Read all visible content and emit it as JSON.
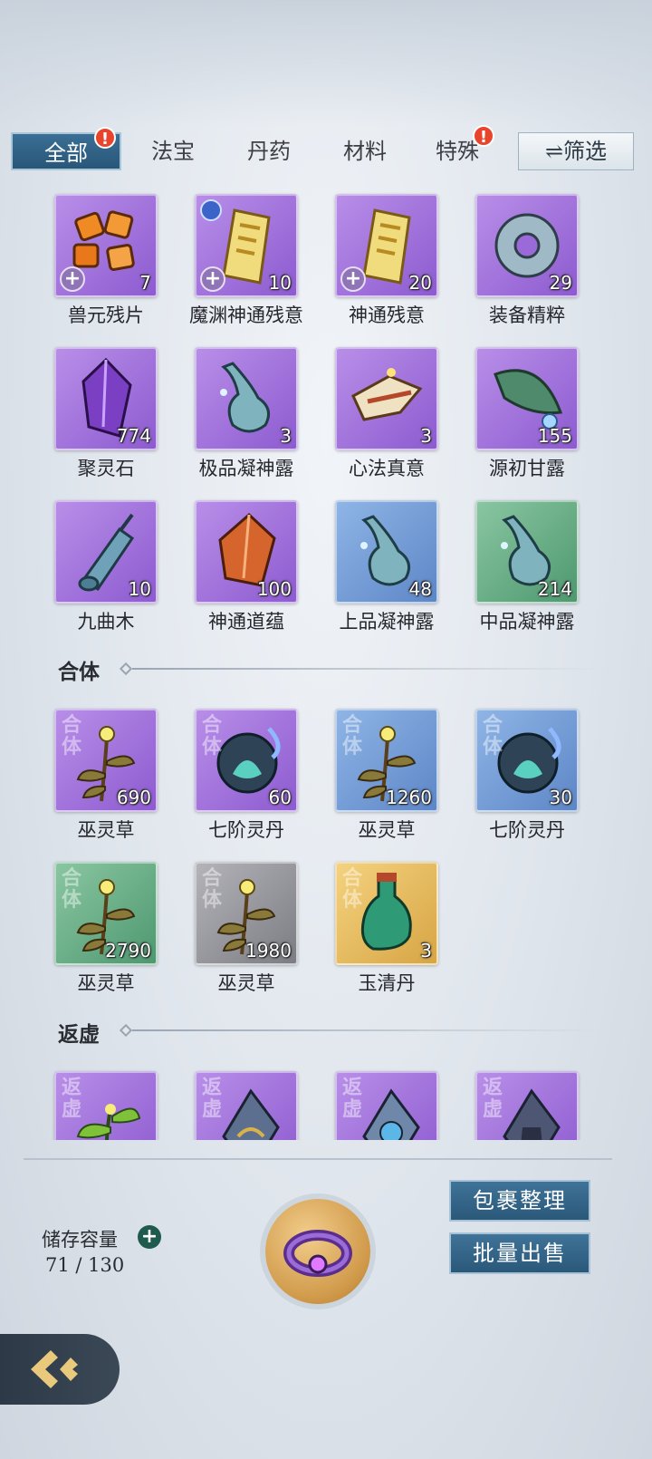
{
  "tabs": [
    {
      "label": "全部",
      "active": true,
      "badge": "!"
    },
    {
      "label": "法宝"
    },
    {
      "label": "丹药"
    },
    {
      "label": "材料"
    },
    {
      "label": "特殊",
      "badge": "!"
    }
  ],
  "filter_label": "⇌筛选",
  "items_top": [
    {
      "name": "兽元残片",
      "count": "7",
      "rarity": "purple",
      "icon": "orange-shards-icon"
    },
    {
      "name": "魔渊神通残意",
      "count": "10",
      "rarity": "purple",
      "icon": "gold-scroll-icon"
    },
    {
      "name": "神通残意",
      "count": "20",
      "rarity": "purple",
      "icon": "gold-scroll-icon"
    },
    {
      "name": "装备精粹",
      "count": "29",
      "rarity": "purple",
      "icon": "jade-ring-icon"
    },
    {
      "name": "聚灵石",
      "count": "774",
      "rarity": "purple",
      "icon": "purple-crystal-icon"
    },
    {
      "name": "极品凝神露",
      "count": "3",
      "rarity": "purple",
      "icon": "dew-vial-icon"
    },
    {
      "name": "心法真意",
      "count": "3",
      "rarity": "purple",
      "icon": "broken-scroll-icon"
    },
    {
      "name": "源初甘露",
      "count": "155",
      "rarity": "purple",
      "icon": "leaf-dew-icon"
    },
    {
      "name": "九曲木",
      "count": "10",
      "rarity": "purple",
      "icon": "wood-log-icon"
    },
    {
      "name": "神通道蕴",
      "count": "100",
      "rarity": "purple",
      "icon": "amber-crystal-icon"
    },
    {
      "name": "上品凝神露",
      "count": "48",
      "rarity": "blue",
      "icon": "dew-vial-icon"
    },
    {
      "name": "中品凝神露",
      "count": "214",
      "rarity": "green",
      "icon": "dew-vial-icon"
    }
  ],
  "section_heti": "合体",
  "stamp_heti": "合体",
  "items_heti": [
    {
      "name": "巫灵草",
      "count": "690",
      "rarity": "purple",
      "icon": "herb-icon"
    },
    {
      "name": "七阶灵丹",
      "count": "60",
      "rarity": "purple",
      "icon": "spirit-orb-icon"
    },
    {
      "name": "巫灵草",
      "count": "1260",
      "rarity": "blue",
      "icon": "herb-icon"
    },
    {
      "name": "七阶灵丹",
      "count": "30",
      "rarity": "blue",
      "icon": "spirit-orb-icon"
    },
    {
      "name": "巫灵草",
      "count": "2790",
      "rarity": "green",
      "icon": "herb-icon"
    },
    {
      "name": "巫灵草",
      "count": "1980",
      "rarity": "gray",
      "icon": "herb-icon"
    },
    {
      "name": "玉清丹",
      "count": "3",
      "rarity": "gold",
      "icon": "potion-bottle-icon"
    }
  ],
  "section_fanxu": "返虚",
  "stamp_fanxu": "返虚",
  "items_fanxu": [
    {
      "rarity": "purple",
      "icon": "green-herb-icon"
    },
    {
      "rarity": "purple",
      "icon": "dark-shard-icon"
    },
    {
      "rarity": "purple",
      "icon": "blue-shard-icon"
    },
    {
      "rarity": "purple",
      "icon": "robe-shard-icon"
    }
  ],
  "storage": {
    "label": "储存容量",
    "value": "71 / 130"
  },
  "buttons": {
    "organize": "包裹整理",
    "bulk_sell": "批量出售"
  },
  "colors": {
    "tab_active": "#2f6488",
    "badge": "#e8452d",
    "purple": "#9a6ad8",
    "blue": "#6f96d3",
    "green": "#5ea67c",
    "gray": "#8e8f96",
    "gold": "#e3b55a"
  }
}
